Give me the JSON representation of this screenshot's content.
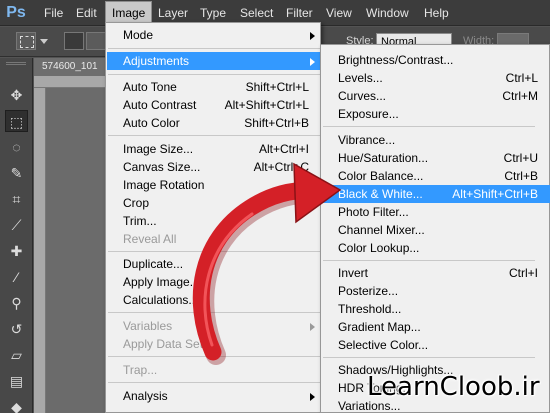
{
  "app": {
    "logo": "Ps"
  },
  "menubar": {
    "items": [
      {
        "label": "File"
      },
      {
        "label": "Edit"
      },
      {
        "label": "Image"
      },
      {
        "label": "Layer"
      },
      {
        "label": "Type"
      },
      {
        "label": "Select"
      },
      {
        "label": "Filter"
      },
      {
        "label": "View"
      },
      {
        "label": "Window"
      },
      {
        "label": "Help"
      }
    ],
    "active": "Image"
  },
  "options_bar": {
    "style_label": "Style:",
    "style_value": "Normal",
    "width_label": "Width:"
  },
  "document": {
    "tab_title": "574600_101"
  },
  "image_menu": {
    "mode": "Mode",
    "adjustments": "Adjustments",
    "auto_tone": {
      "label": "Auto Tone",
      "shortcut": "Shift+Ctrl+L"
    },
    "auto_contrast": {
      "label": "Auto Contrast",
      "shortcut": "Alt+Shift+Ctrl+L"
    },
    "auto_color": {
      "label": "Auto Color",
      "shortcut": "Shift+Ctrl+B"
    },
    "image_size": {
      "label": "Image Size...",
      "shortcut": "Alt+Ctrl+I"
    },
    "canvas_size": {
      "label": "Canvas Size...",
      "shortcut": "Alt+Ctrl+C"
    },
    "image_rotation": "Image Rotation",
    "crop": "Crop",
    "trim": "Trim...",
    "reveal_all": "Reveal All",
    "duplicate": "Duplicate...",
    "apply_image": "Apply Image...",
    "calculations": "Calculations...",
    "variables": "Variables",
    "apply_data_set": "Apply Data Set...",
    "trap": "Trap...",
    "analysis": "Analysis"
  },
  "adjustments_menu": {
    "brightness_contrast": "Brightness/Contrast...",
    "levels": {
      "label": "Levels...",
      "shortcut": "Ctrl+L"
    },
    "curves": {
      "label": "Curves...",
      "shortcut": "Ctrl+M"
    },
    "exposure": "Exposure...",
    "vibrance": "Vibrance...",
    "hue_saturation": {
      "label": "Hue/Saturation...",
      "shortcut": "Ctrl+U"
    },
    "color_balance": {
      "label": "Color Balance...",
      "shortcut": "Ctrl+B"
    },
    "black_white": {
      "label": "Black & White...",
      "shortcut": "Alt+Shift+Ctrl+B"
    },
    "photo_filter": "Photo Filter...",
    "channel_mixer": "Channel Mixer...",
    "color_lookup": "Color Lookup...",
    "invert": {
      "label": "Invert",
      "shortcut": "Ctrl+I"
    },
    "posterize": "Posterize...",
    "threshold": "Threshold...",
    "gradient_map": "Gradient Map...",
    "selective_color": "Selective Color...",
    "shadows_highlights": "Shadows/Highlights...",
    "hdr_toning": "HDR Toning...",
    "variations": "Variations..."
  },
  "watermark": "LearnCloob.ir",
  "colors": {
    "highlight": "#3399ff",
    "arrow": "#d42027",
    "menubar_bg": "#3c3c3c"
  }
}
